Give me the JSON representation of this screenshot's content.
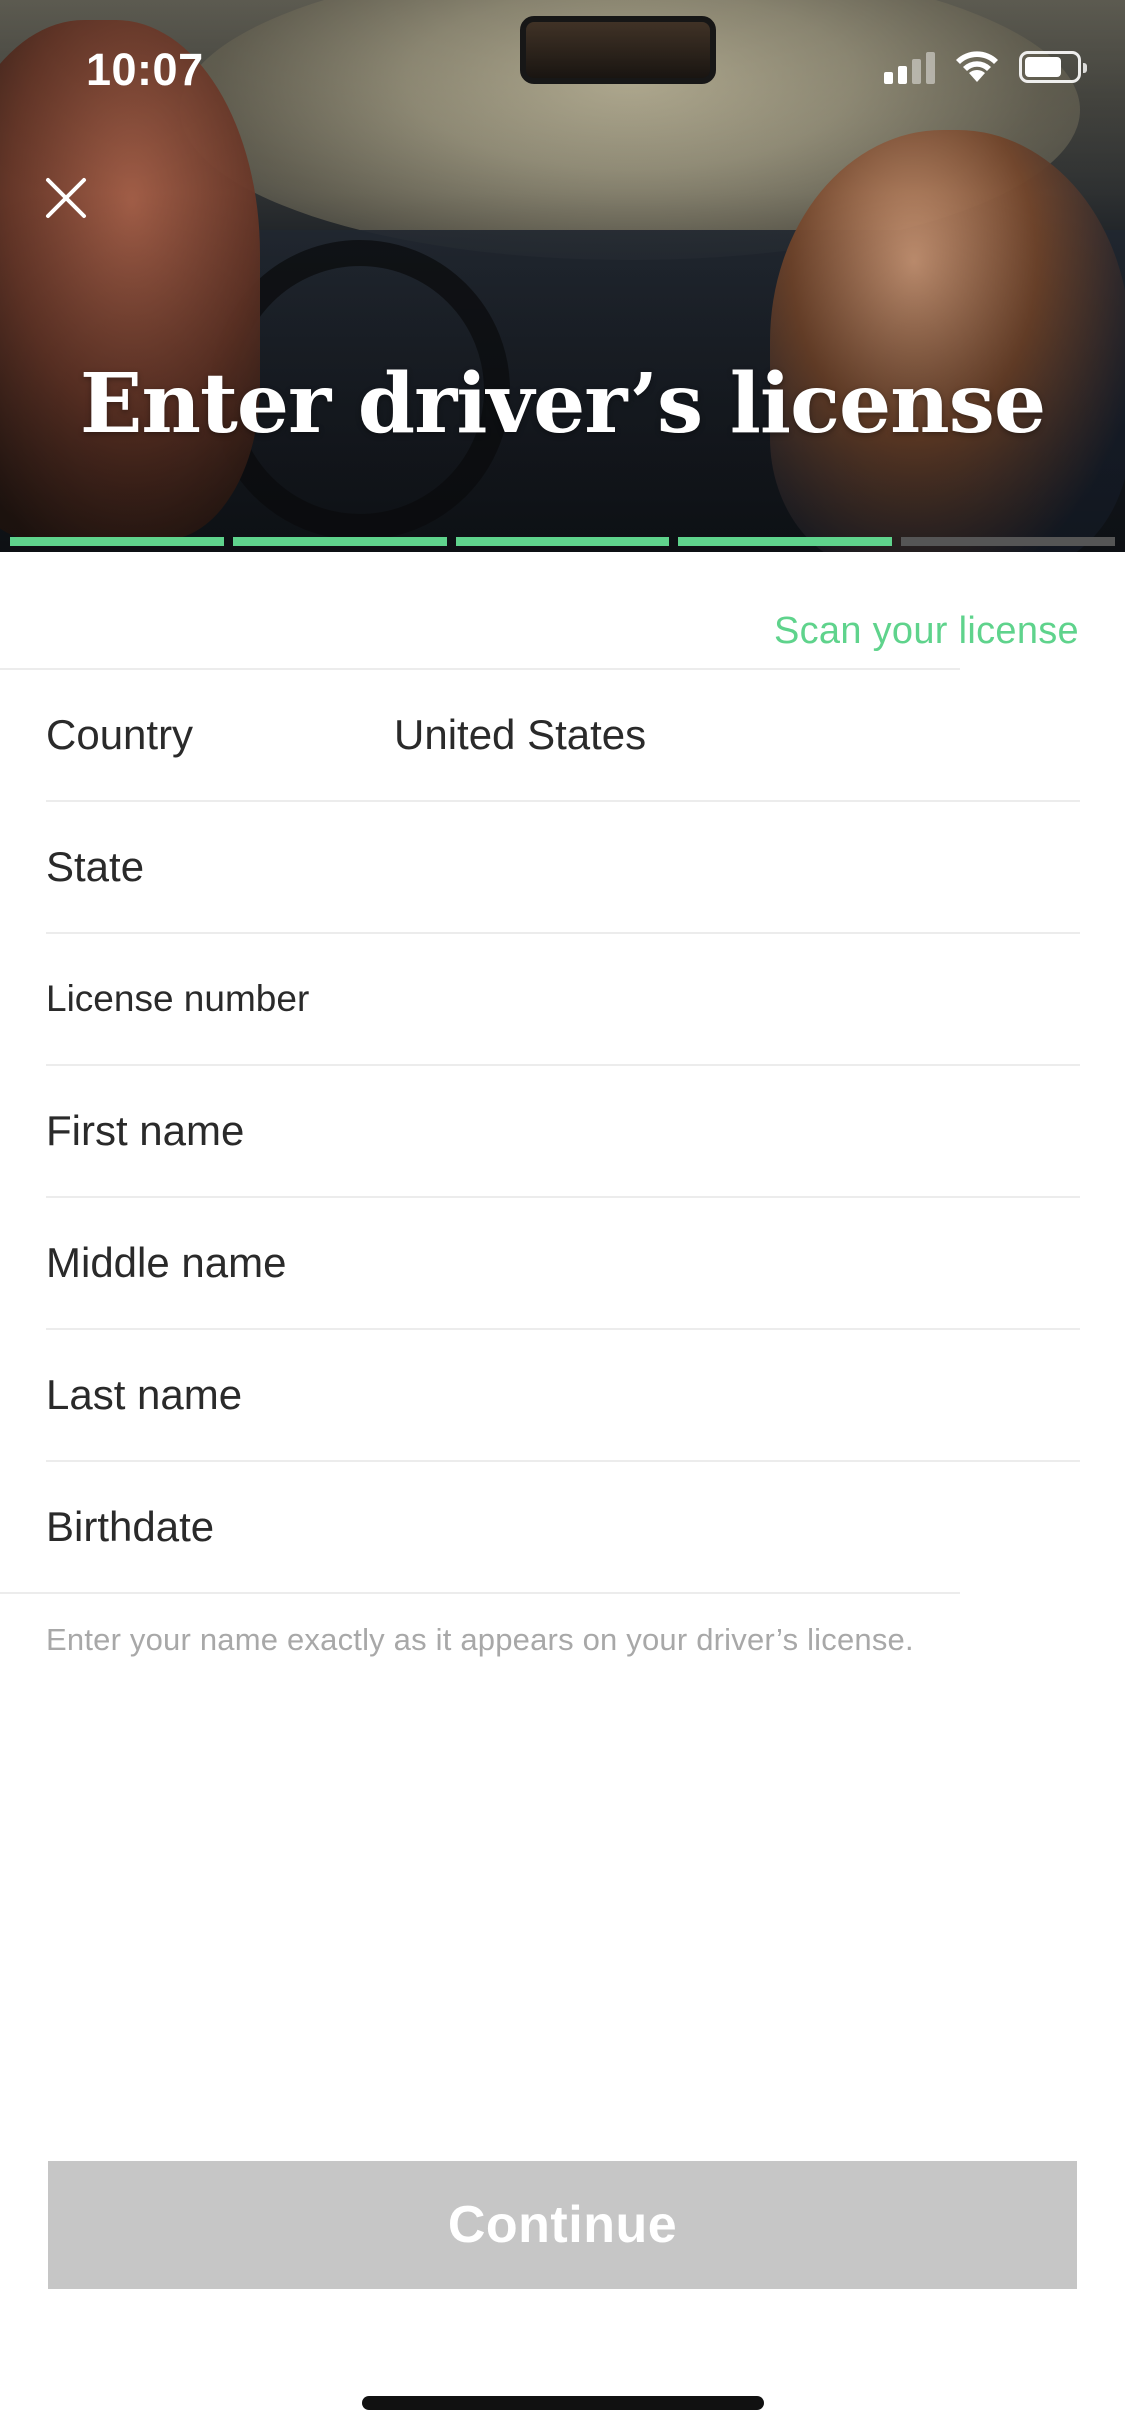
{
  "status_bar": {
    "time": "10:07",
    "icons": [
      "cellular-signal-icon",
      "wifi-icon",
      "battery-icon"
    ]
  },
  "header": {
    "title": "Enter driver’s license",
    "close_icon": "close-icon",
    "progress": {
      "total_steps": 5,
      "completed_steps": 4
    }
  },
  "scan_link": {
    "label": "Scan your license"
  },
  "form": {
    "fields": [
      {
        "label": "Country",
        "value": "United States"
      },
      {
        "label": "State",
        "value": ""
      },
      {
        "label": "License number",
        "value": ""
      },
      {
        "label": "First name",
        "value": ""
      },
      {
        "label": "Middle name",
        "value": ""
      },
      {
        "label": "Last name",
        "value": ""
      },
      {
        "label": "Birthdate",
        "value": ""
      }
    ],
    "hint": "Enter your name exactly as it appears on your driver’s license."
  },
  "actions": {
    "continue_label": "Continue"
  },
  "colors": {
    "accent": "#5fd38c",
    "progress_inactive": "#555555",
    "button_disabled": "#c6c6c6",
    "hint_text": "#a8a8a8"
  }
}
